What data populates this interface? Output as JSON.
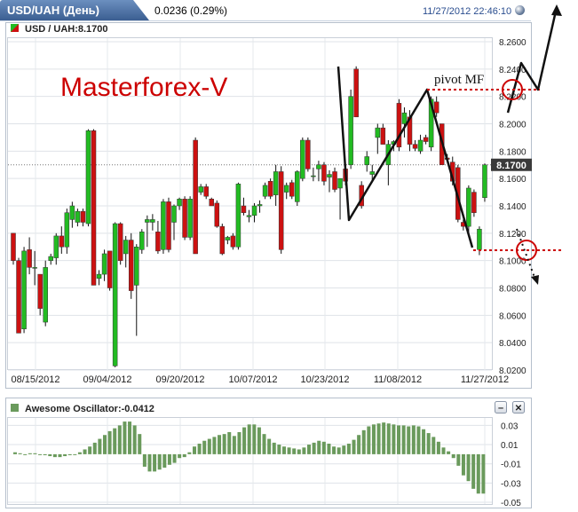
{
  "window": {
    "symbol_title": "USD/UAH (День)",
    "change": "0.0236 (0.29%)",
    "timestamp": "11/27/2012 22:46:10"
  },
  "main_panel": {
    "label": "USD / UAH:8.1700",
    "last_price_label": "8.1700",
    "watermark": "Masterforex-V",
    "pivot_label": "pivot MF"
  },
  "oscillator_panel": {
    "label": "Awesome Oscillator:-0.0412",
    "minimize_label": "–",
    "close_label": "✕"
  },
  "colors": {
    "up_candle": "#22bb22",
    "down_candle": "#cc1111",
    "oscillator_bar": "#6a9a5c",
    "watermark": "#cc0000",
    "pivot_line": "#cc0000",
    "last_price_box": "#3a3a3a"
  },
  "chart_data": [
    {
      "type": "candlestick",
      "title": "USD / UAH:8.1700",
      "x_ticks": [
        "08/15/2012",
        "09/04/2012",
        "09/20/2012",
        "10/07/2012",
        "10/23/2012",
        "11/08/2012",
        "11/27/2012"
      ],
      "y_ticks": [
        "8.2600",
        "8.2400",
        "8.2200",
        "8.2000",
        "8.1800",
        "8.1600",
        "8.1400",
        "8.1200",
        "8.1000",
        "8.0800",
        "8.0600",
        "8.0400",
        "8.0200"
      ],
      "ylim": [
        8.02,
        8.26
      ],
      "last_price": 8.17,
      "grid": true,
      "candles": [
        [
          8.12,
          8.12,
          8.097,
          8.1
        ],
        [
          8.1,
          8.102,
          8.047,
          8.047
        ],
        [
          8.05,
          8.11,
          8.047,
          8.107
        ],
        [
          8.108,
          8.117,
          8.09,
          8.095
        ],
        [
          8.095,
          8.107,
          8.082,
          8.095
        ],
        [
          8.09,
          8.09,
          8.06,
          8.065
        ],
        [
          8.055,
          8.1,
          8.052,
          8.095
        ],
        [
          8.1,
          8.105,
          8.097,
          8.103
        ],
        [
          8.102,
          8.12,
          8.097,
          8.118
        ],
        [
          8.118,
          8.125,
          8.105,
          8.11
        ],
        [
          8.11,
          8.138,
          8.105,
          8.135
        ],
        [
          8.13,
          8.143,
          8.124,
          8.14
        ],
        [
          8.128,
          8.138,
          8.125,
          8.136
        ],
        [
          8.136,
          8.138,
          8.125,
          8.128
        ],
        [
          8.127,
          8.196,
          8.125,
          8.195
        ],
        [
          8.195,
          8.196,
          8.082,
          8.082
        ],
        [
          8.087,
          8.093,
          8.082,
          8.09
        ],
        [
          8.09,
          8.108,
          8.085,
          8.105
        ],
        [
          8.107,
          8.107,
          8.078,
          8.08
        ],
        [
          8.023,
          8.128,
          8.022,
          8.127
        ],
        [
          8.127,
          8.128,
          8.097,
          8.1
        ],
        [
          8.105,
          8.118,
          8.095,
          8.115
        ],
        [
          8.115,
          8.12,
          8.072,
          8.078
        ],
        [
          8.082,
          8.112,
          8.045,
          8.11
        ],
        [
          8.108,
          8.123,
          8.105,
          8.121
        ],
        [
          8.128,
          8.133,
          8.11,
          8.13
        ],
        [
          8.128,
          8.134,
          8.122,
          8.13
        ],
        [
          8.121,
          8.129,
          8.105,
          8.107
        ],
        [
          8.108,
          8.145,
          8.105,
          8.143
        ],
        [
          8.143,
          8.146,
          8.106,
          8.108
        ],
        [
          8.128,
          8.141,
          8.115,
          8.14
        ],
        [
          8.14,
          8.146,
          8.137,
          8.145
        ],
        [
          8.145,
          8.147,
          8.115,
          8.117
        ],
        [
          8.117,
          8.147,
          8.115,
          8.145
        ],
        [
          8.188,
          8.19,
          8.105,
          8.105
        ],
        [
          8.15,
          8.156,
          8.148,
          8.154
        ],
        [
          8.154,
          8.156,
          8.145,
          8.147
        ],
        [
          8.145,
          8.146,
          8.14,
          8.14
        ],
        [
          8.142,
          8.144,
          8.124,
          8.125
        ],
        [
          8.125,
          8.127,
          8.104,
          8.105
        ],
        [
          8.115,
          8.118,
          8.112,
          8.117
        ],
        [
          8.118,
          8.12,
          8.108,
          8.11
        ],
        [
          8.11,
          8.157,
          8.108,
          8.156
        ],
        [
          8.14,
          8.146,
          8.133,
          8.135
        ],
        [
          8.132,
          8.137,
          8.128,
          8.133
        ],
        [
          8.133,
          8.142,
          8.128,
          8.14
        ],
        [
          8.14,
          8.144,
          8.135,
          8.141
        ],
        [
          8.147,
          8.157,
          8.145,
          8.155
        ],
        [
          8.158,
          8.16,
          8.145,
          8.147
        ],
        [
          8.148,
          8.17,
          8.14,
          8.165
        ],
        [
          8.165,
          8.169,
          8.105,
          8.108
        ],
        [
          8.15,
          8.157,
          8.145,
          8.155
        ],
        [
          8.157,
          8.159,
          8.145,
          8.147
        ],
        [
          8.143,
          8.166,
          8.14,
          8.165
        ],
        [
          8.16,
          8.19,
          8.158,
          8.188
        ],
        [
          8.188,
          8.19,
          8.165,
          8.167
        ],
        [
          8.162,
          8.168,
          8.158,
          8.162
        ],
        [
          8.167,
          8.173,
          8.158,
          8.17
        ],
        [
          8.17,
          8.172,
          8.155,
          8.158
        ],
        [
          8.161,
          8.166,
          8.15,
          8.163
        ],
        [
          8.165,
          8.168,
          8.15,
          8.152
        ],
        [
          8.153,
          8.16,
          8.13,
          8.16
        ],
        [
          8.167,
          8.17,
          8.155,
          8.158
        ],
        [
          8.17,
          8.225,
          8.167,
          8.22
        ],
        [
          8.24,
          8.242,
          8.205,
          8.205
        ],
        [
          8.155,
          8.158,
          8.138,
          8.14
        ],
        [
          8.17,
          8.18,
          8.165,
          8.176
        ],
        [
          8.163,
          8.17,
          8.158,
          8.165
        ],
        [
          8.19,
          8.2,
          8.178,
          8.197
        ],
        [
          8.197,
          8.2,
          8.185,
          8.185
        ],
        [
          8.17,
          8.188,
          8.155,
          8.185
        ],
        [
          8.185,
          8.188,
          8.18,
          8.187
        ],
        [
          8.215,
          8.218,
          8.18,
          8.183
        ],
        [
          8.2,
          8.212,
          8.19,
          8.208
        ],
        [
          8.205,
          8.21,
          8.18,
          8.185
        ],
        [
          8.185,
          8.188,
          8.18,
          8.182
        ],
        [
          8.18,
          8.192,
          8.178,
          8.188
        ],
        [
          8.19,
          8.192,
          8.185,
          8.187
        ],
        [
          8.183,
          8.22,
          8.18,
          8.218
        ],
        [
          8.216,
          8.22,
          8.205,
          8.208
        ],
        [
          8.2,
          8.2,
          8.17,
          8.17
        ],
        [
          8.175,
          8.178,
          8.172,
          8.174
        ],
        [
          8.172,
          8.176,
          8.155,
          8.158
        ],
        [
          8.168,
          8.17,
          8.128,
          8.13
        ],
        [
          8.128,
          8.13,
          8.122,
          8.125
        ],
        [
          8.125,
          8.155,
          8.12,
          8.153
        ],
        [
          8.15,
          8.152,
          8.132,
          8.135
        ],
        [
          8.108,
          8.125,
          8.104,
          8.123
        ],
        [
          8.146,
          8.171,
          8.143,
          8.17
        ]
      ]
    },
    {
      "type": "bar",
      "title": "Awesome Oscillator:-0.0412",
      "y_ticks": [
        "0.03",
        "0.01",
        "-0.01",
        "-0.03",
        "-0.05"
      ],
      "ylim": [
        -0.05,
        0.035
      ],
      "grid": true,
      "values": [
        0.002,
        0.001,
        0.0,
        0.001,
        0.001,
        0.0,
        -0.001,
        -0.002,
        -0.003,
        -0.003,
        -0.002,
        -0.001,
        0.0,
        0.002,
        0.005,
        0.008,
        0.012,
        0.016,
        0.02,
        0.024,
        0.027,
        0.03,
        0.034,
        0.034,
        0.03,
        0.021,
        -0.013,
        -0.018,
        -0.018,
        -0.016,
        -0.014,
        -0.011,
        -0.009,
        -0.004,
        -0.003,
        0.002,
        0.008,
        0.011,
        0.014,
        0.016,
        0.018,
        0.02,
        0.021,
        0.023,
        0.019,
        0.023,
        0.028,
        0.031,
        0.031,
        0.028,
        0.021,
        0.016,
        0.012,
        0.01,
        0.008,
        0.007,
        0.006,
        0.005,
        0.007,
        0.01,
        0.012,
        0.014,
        0.013,
        0.011,
        0.008,
        0.007,
        0.009,
        0.011,
        0.015,
        0.02,
        0.025,
        0.029,
        0.031,
        0.032,
        0.033,
        0.032,
        0.031,
        0.03,
        0.03,
        0.029,
        0.03,
        0.029,
        0.026,
        0.022,
        0.018,
        0.013,
        0.007,
        0.003,
        -0.004,
        -0.012,
        -0.022,
        -0.028,
        -0.036,
        -0.041,
        -0.041
      ]
    }
  ]
}
